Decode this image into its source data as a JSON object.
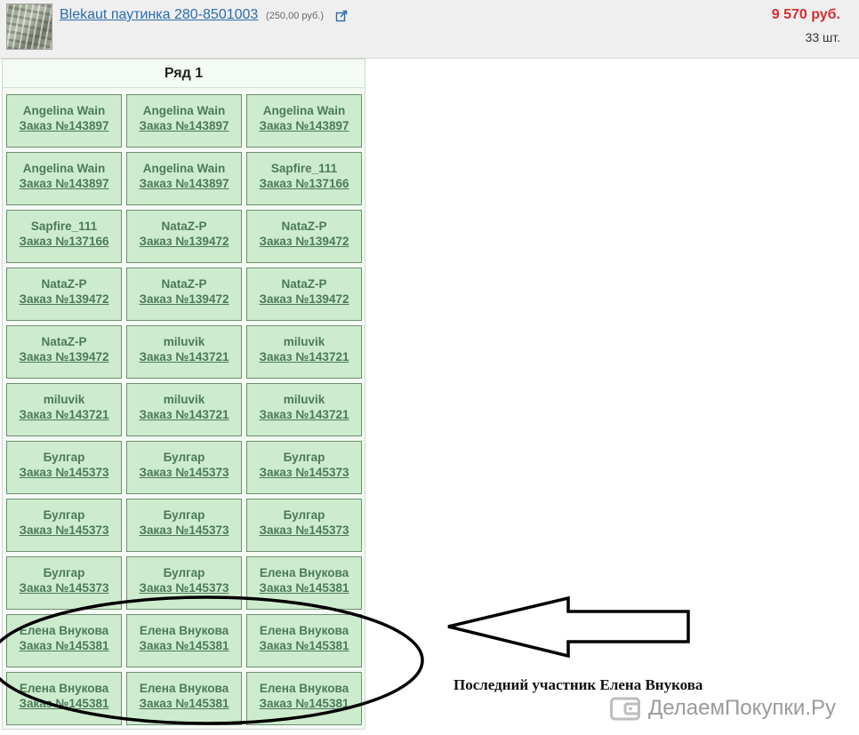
{
  "product": {
    "name": "Blekaut паутинка 280-8501003",
    "price": "(250,00 руб.)",
    "total": "9 570 руб.",
    "quantity": "33 шт.",
    "icons": {
      "thumbnail": "product-photo",
      "external": "external-link-icon"
    }
  },
  "grid": {
    "title": "Ряд 1",
    "cells": [
      {
        "name": "Angelina Wain",
        "order": "Заказ №143897"
      },
      {
        "name": "Angelina Wain",
        "order": "Заказ №143897"
      },
      {
        "name": "Angelina Wain",
        "order": "Заказ №143897"
      },
      {
        "name": "Angelina Wain",
        "order": "Заказ №143897"
      },
      {
        "name": "Angelina Wain",
        "order": "Заказ №143897"
      },
      {
        "name": "Sapfire_111",
        "order": "Заказ №137166"
      },
      {
        "name": "Sapfire_111",
        "order": "Заказ №137166"
      },
      {
        "name": "NataZ-P",
        "order": "Заказ №139472"
      },
      {
        "name": "NataZ-P",
        "order": "Заказ №139472"
      },
      {
        "name": "NataZ-P",
        "order": "Заказ №139472"
      },
      {
        "name": "NataZ-P",
        "order": "Заказ №139472"
      },
      {
        "name": "NataZ-P",
        "order": "Заказ №139472"
      },
      {
        "name": "NataZ-P",
        "order": "Заказ №139472"
      },
      {
        "name": "miluvik",
        "order": "Заказ №143721"
      },
      {
        "name": "miluvik",
        "order": "Заказ №143721"
      },
      {
        "name": "miluvik",
        "order": "Заказ №143721"
      },
      {
        "name": "miluvik",
        "order": "Заказ №143721"
      },
      {
        "name": "miluvik",
        "order": "Заказ №143721"
      },
      {
        "name": "Булгар",
        "order": "Заказ №145373"
      },
      {
        "name": "Булгар",
        "order": "Заказ №145373"
      },
      {
        "name": "Булгар",
        "order": "Заказ №145373"
      },
      {
        "name": "Булгар",
        "order": "Заказ №145373"
      },
      {
        "name": "Булгар",
        "order": "Заказ №145373"
      },
      {
        "name": "Булгар",
        "order": "Заказ №145373"
      },
      {
        "name": "Булгар",
        "order": "Заказ №145373"
      },
      {
        "name": "Булгар",
        "order": "Заказ №145373"
      },
      {
        "name": "Елена Внукова",
        "order": "Заказ №145381"
      },
      {
        "name": "Елена Внукова",
        "order": "Заказ №145381"
      },
      {
        "name": "Елена Внукова",
        "order": "Заказ №145381"
      },
      {
        "name": "Елена Внукова",
        "order": "Заказ №145381"
      },
      {
        "name": "Елена Внукова",
        "order": "Заказ №145381"
      },
      {
        "name": "Елена Внукова",
        "order": "Заказ №145381"
      },
      {
        "name": "Елена Внукова",
        "order": "Заказ №145381"
      }
    ]
  },
  "annotation": {
    "text": "Последний участник Елена Внукова",
    "shapes": [
      "ellipse",
      "arrow-left"
    ]
  },
  "watermark": {
    "text": "ДелаемПокупки.Ру",
    "icon": "wallet-icon"
  },
  "colors": {
    "link": "#2b6cb0",
    "total": "#d32f2f",
    "cell_bg": "#cdeccd",
    "cell_text": "#4b7a5a"
  }
}
